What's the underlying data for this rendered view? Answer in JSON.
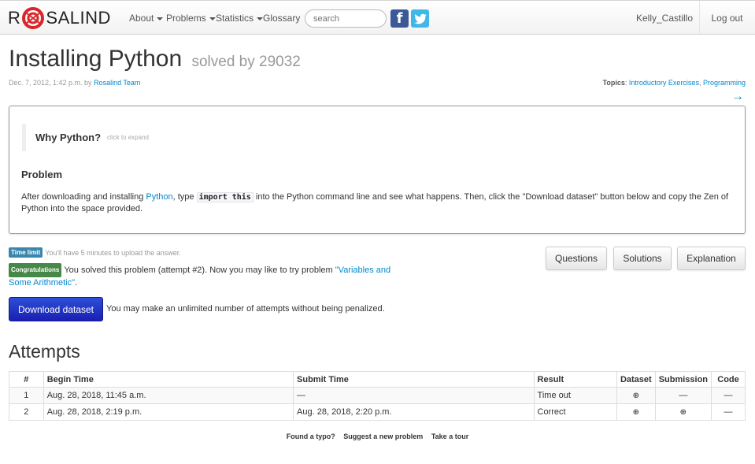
{
  "nav": {
    "brand_left": "R",
    "brand_right": "SALIND",
    "items": [
      "About",
      "Problems",
      "Statistics",
      "Glossary"
    ],
    "search_placeholder": "search",
    "user": "Kelly_Castillo",
    "logout": "Log out"
  },
  "header": {
    "title": "Installing Python",
    "solved_by": "solved by 29032",
    "meta_prefix": "Dec. 7, 2012, 1:42 p.m. by ",
    "author": "Rosalind Team",
    "topics_label": "Topics",
    "topics_sep": ": ",
    "topic1": "Introductory Exercises",
    "topic_comma": ", ",
    "topic2": "Programming",
    "next_arrow": "→"
  },
  "problem": {
    "why_title": "Why Python?",
    "why_hint": "click to expand",
    "heading": "Problem",
    "text_a": "After downloading and installing ",
    "text_link": "Python",
    "text_b": ", type ",
    "text_code": "import this",
    "text_c": " into the Python command line and see what happens. Then, click the \"Download dataset\" button below and copy the Zen of Python into the space provided."
  },
  "status": {
    "time_label": "Time limit",
    "time_text": "You'll have 5 minutes to upload the answer.",
    "congrats_label": "Congratulations",
    "congrats_text": "You solved this problem (attempt #2). Now you may like to try problem ",
    "next_problem": "\"Variables and Some Arithmetic\"",
    "period": "."
  },
  "buttons": {
    "questions": "Questions",
    "solutions": "Solutions",
    "explanation": "Explanation",
    "download": "Download dataset",
    "download_note": "You may make an unlimited number of attempts without being penalized."
  },
  "attempts": {
    "heading": "Attempts",
    "columns": [
      "#",
      "Begin Time",
      "Submit Time",
      "Result",
      "Dataset",
      "Submission",
      "Code"
    ],
    "rows": [
      {
        "num": "1",
        "begin": "Aug. 28, 2018, 11:45 a.m.",
        "submit": "—",
        "result": "Time out",
        "dataset": "⊕",
        "submission": "—",
        "code": "—"
      },
      {
        "num": "2",
        "begin": "Aug. 28, 2018, 2:19 p.m.",
        "submit": "Aug. 28, 2018, 2:20 p.m.",
        "result": "Correct",
        "dataset": "⊕",
        "submission": "⊕",
        "code": "—"
      }
    ]
  },
  "footer": {
    "typo": "Found a typo?",
    "suggest": "Suggest a new problem",
    "tour": "Take a tour"
  },
  "colors": {
    "link": "#0088cc",
    "label_info": "#3a87ad",
    "label_success": "#468847",
    "download_button": "#2c4fd6"
  }
}
